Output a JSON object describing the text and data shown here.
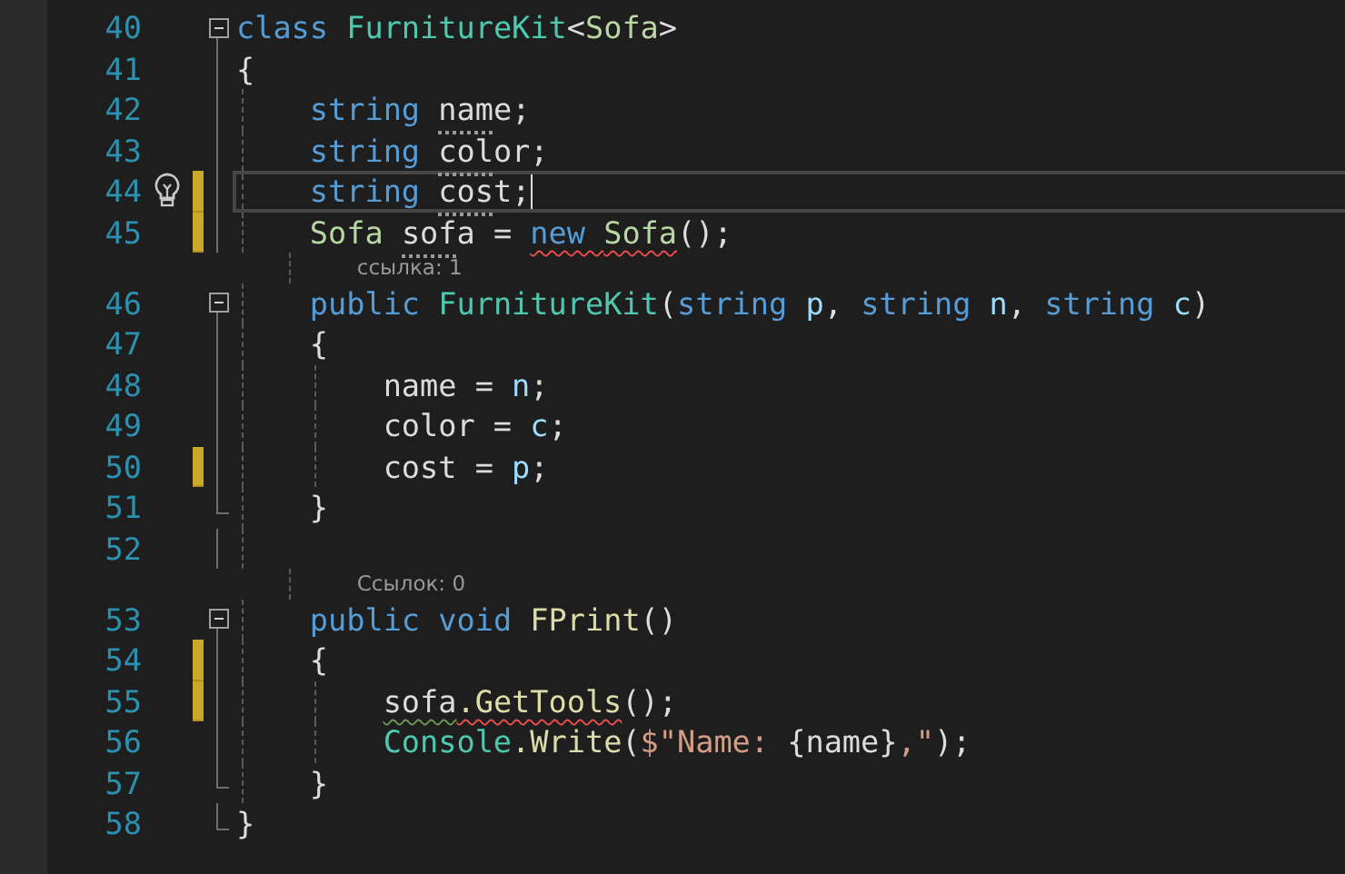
{
  "lines": [
    {
      "kind": "code",
      "number": "40",
      "expanded": true,
      "tokens": [
        {
          "t": "class ",
          "kind": "keyword"
        },
        {
          "t": "FurnitureKit",
          "kind": "type"
        },
        {
          "t": "<",
          "kind": "plain"
        },
        {
          "t": "Sofa",
          "kind": "typeparam"
        },
        {
          "t": ">",
          "kind": "plain"
        }
      ]
    },
    {
      "kind": "code",
      "number": "41",
      "tokens": [
        {
          "t": "{",
          "kind": "plain"
        }
      ],
      "children": [
        {
          "kind": "code",
          "number": "42",
          "tokens": [
            {
              "t": "string ",
              "kind": "keyword"
            },
            {
              "t": "name",
              "kind": "plain",
              "hint": true
            },
            {
              "t": ";",
              "kind": "plain"
            }
          ]
        },
        {
          "kind": "code",
          "number": "43",
          "tokens": [
            {
              "t": "string ",
              "kind": "keyword"
            },
            {
              "t": "color",
              "kind": "plain",
              "hint": true
            },
            {
              "t": ";",
              "kind": "plain"
            }
          ]
        },
        {
          "kind": "code",
          "number": "44",
          "changed": true,
          "lightbulb": true,
          "current": true,
          "tokens": [
            {
              "t": "string ",
              "kind": "keyword"
            },
            {
              "t": "cost",
              "kind": "plain",
              "hint": true
            },
            {
              "t": ";",
              "kind": "plain"
            }
          ]
        },
        {
          "kind": "code",
          "number": "45",
          "changed": true,
          "tokens": [
            {
              "t": "Sofa ",
              "kind": "typeparam"
            },
            {
              "t": "sofa",
              "kind": "plain",
              "hint": true
            },
            {
              "t": " = ",
              "kind": "plain"
            },
            {
              "t": "new ",
              "kind": "keyword",
              "error": true
            },
            {
              "t": "Sofa",
              "kind": "typeparam",
              "error": true
            },
            {
              "t": "();",
              "kind": "plain"
            }
          ]
        },
        {
          "kind": "codelens",
          "text": "ссылка: 1"
        },
        {
          "kind": "code",
          "number": "46",
          "expanded": true,
          "tokens": [
            {
              "t": "public ",
              "kind": "keyword"
            },
            {
              "t": "FurnitureKit",
              "kind": "type"
            },
            {
              "t": "(",
              "kind": "plain"
            },
            {
              "t": "string ",
              "kind": "keyword"
            },
            {
              "t": "p",
              "kind": "param"
            },
            {
              "t": ", ",
              "kind": "plain"
            },
            {
              "t": "string ",
              "kind": "keyword"
            },
            {
              "t": "n",
              "kind": "param"
            },
            {
              "t": ", ",
              "kind": "plain"
            },
            {
              "t": "string ",
              "kind": "keyword"
            },
            {
              "t": "c",
              "kind": "param"
            },
            {
              "t": ")",
              "kind": "plain"
            }
          ]
        },
        {
          "kind": "code",
          "number": "47",
          "tokens": [
            {
              "t": "{",
              "kind": "plain"
            }
          ],
          "children": [
            {
              "kind": "code",
              "number": "48",
              "tokens": [
                {
                  "t": "name = ",
                  "kind": "plain"
                },
                {
                  "t": "n",
                  "kind": "param"
                },
                {
                  "t": ";",
                  "kind": "plain"
                }
              ]
            },
            {
              "kind": "code",
              "number": "49",
              "tokens": [
                {
                  "t": "color = ",
                  "kind": "plain"
                },
                {
                  "t": "c",
                  "kind": "param"
                },
                {
                  "t": ";",
                  "kind": "plain"
                }
              ]
            },
            {
              "kind": "code",
              "number": "50",
              "changed": true,
              "tokens": [
                {
                  "t": "cost = ",
                  "kind": "plain"
                },
                {
                  "t": "p",
                  "kind": "param"
                },
                {
                  "t": ";",
                  "kind": "plain"
                }
              ]
            }
          ]
        },
        {
          "kind": "code",
          "number": "51",
          "fold_end": true,
          "tokens": [
            {
              "t": "}",
              "kind": "plain"
            }
          ]
        },
        {
          "kind": "code",
          "number": "52"
        },
        {
          "kind": "codelens",
          "text": "Ссылок: 0"
        },
        {
          "kind": "code",
          "number": "53",
          "expanded": true,
          "tokens": [
            {
              "t": "public ",
              "kind": "keyword"
            },
            {
              "t": "void ",
              "kind": "keyword"
            },
            {
              "t": "FPrint",
              "kind": "method"
            },
            {
              "t": "()",
              "kind": "plain"
            }
          ]
        },
        {
          "kind": "code",
          "number": "54",
          "changed": true,
          "tokens": [
            {
              "t": "{",
              "kind": "plain"
            }
          ],
          "children": [
            {
              "kind": "code",
              "number": "55",
              "changed": true,
              "tokens": [
                {
                  "t": "sofa",
                  "kind": "plain",
                  "warning": true
                },
                {
                  "t": ".GetTools",
                  "kind": "method",
                  "error": true
                },
                {
                  "t": "();",
                  "kind": "plain"
                }
              ]
            },
            {
              "kind": "code",
              "number": "56",
              "tokens": [
                {
                  "t": "Console",
                  "kind": "type"
                },
                {
                  "t": ".Write",
                  "kind": "method"
                },
                {
                  "t": "(",
                  "kind": "plain"
                },
                {
                  "t": "$\"Name: ",
                  "kind": "string"
                },
                {
                  "t": "{name}",
                  "kind": "plain"
                },
                {
                  "t": ",\"",
                  "kind": "string"
                },
                {
                  "t": ");",
                  "kind": "plain"
                }
              ]
            }
          ]
        },
        {
          "kind": "code",
          "number": "57",
          "fold_end": true,
          "tokens": [
            {
              "t": "}",
              "kind": "plain"
            }
          ]
        }
      ]
    },
    {
      "kind": "code",
      "number": "58",
      "fold_end": true,
      "tokens": [
        {
          "t": "}",
          "kind": "plain"
        }
      ]
    }
  ]
}
